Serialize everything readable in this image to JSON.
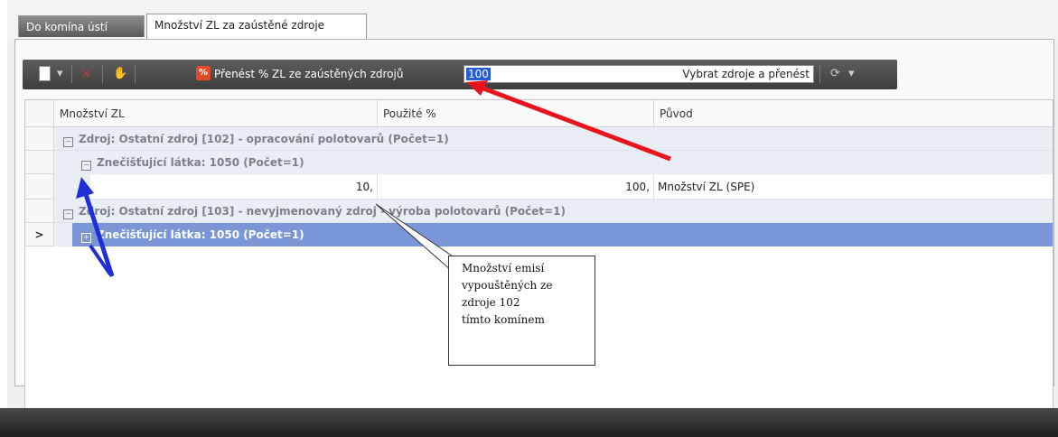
{
  "tabs": [
    {
      "label": "Do komína ústí"
    },
    {
      "label": "Množství ZL za zaústěné zdroje"
    }
  ],
  "toolbar": {
    "export_label": "Přenést % ZL ze zaústěných zdrojů",
    "input_value": "100",
    "select_button_label": "Vybrat zdroje a přenést"
  },
  "grid": {
    "columns": [
      "Množství ZL",
      "Použité %",
      "Původ"
    ],
    "group1": "Zdroj: Ostatní zdroj [102] - opracování polotovarů (Počet=1)",
    "group1_sub": "Znečišťující látka: 1050 (Počet=1)",
    "data_row": {
      "amount": "10,",
      "percent": "100,",
      "origin": "Množství ZL (SPE)"
    },
    "group2": "Zdroj: Ostatní zdroj [103] - nevyjmenovaný zdroj - výroba polotovarů (Počet=1)",
    "group2_sub": "Znečišťující látka: 1050 (Počet=1)",
    "row_indicator": ">"
  },
  "callout": {
    "lines": [
      "Množství emisí",
      "vypouštěných ze",
      "zdroje 102",
      "tímto komínem"
    ]
  },
  "colors": {
    "selected_row": "#7b96d6",
    "group_row": "#e9eef5",
    "arrow_red": "#e8141e",
    "arrow_blue": "#1e2fd8"
  }
}
